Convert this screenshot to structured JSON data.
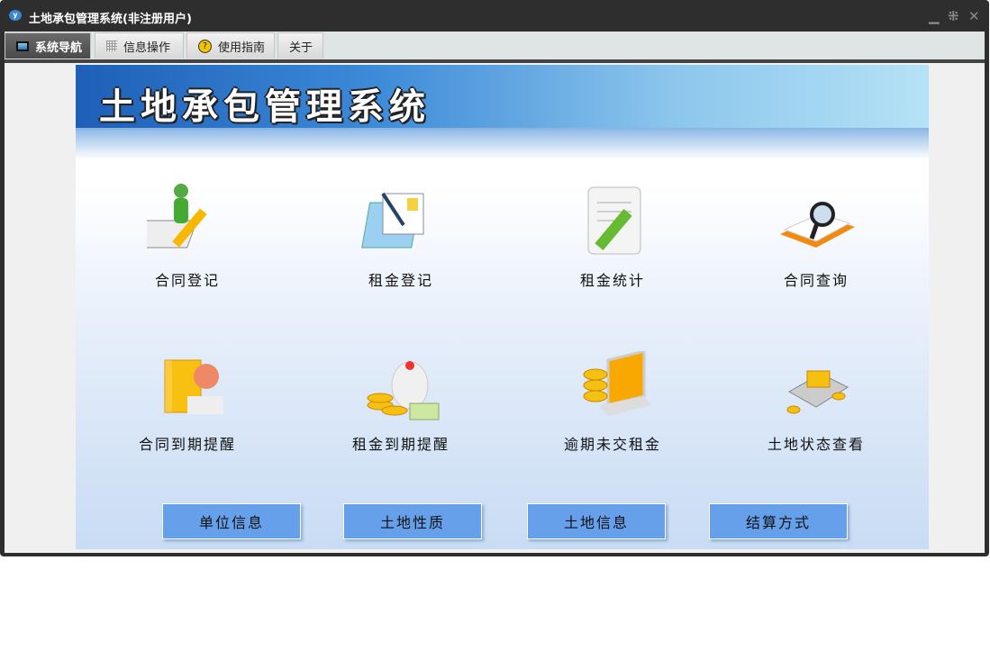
{
  "window": {
    "title": "土地承包管理系统(非注册用户)"
  },
  "tabs": [
    {
      "label": "系统导航"
    },
    {
      "label": "信息操作"
    },
    {
      "label": "使用指南"
    },
    {
      "label": "关于"
    }
  ],
  "banner": {
    "title": "土地承包管理系统"
  },
  "modules": [
    {
      "label": "合同登记",
      "icon": "contract-register-icon"
    },
    {
      "label": "租金登记",
      "icon": "rent-register-icon"
    },
    {
      "label": "租金统计",
      "icon": "rent-statistics-icon"
    },
    {
      "label": "合同查询",
      "icon": "contract-search-icon"
    },
    {
      "label": "合同到期提醒",
      "icon": "contract-expiry-icon"
    },
    {
      "label": "租金到期提醒",
      "icon": "rent-expiry-icon"
    },
    {
      "label": "逾期未交租金",
      "icon": "overdue-rent-icon"
    },
    {
      "label": "土地状态查看",
      "icon": "land-status-icon"
    }
  ],
  "buttons": [
    {
      "label": "单位信息"
    },
    {
      "label": "土地性质"
    },
    {
      "label": "土地信息"
    },
    {
      "label": "结算方式"
    }
  ]
}
